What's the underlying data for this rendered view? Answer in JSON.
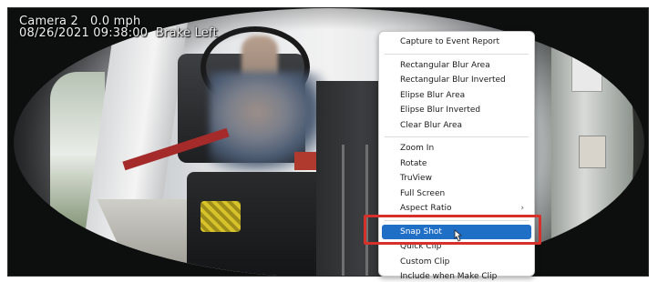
{
  "overlay": {
    "line1": "Camera 2   0.0 mph",
    "line2": "08/26/2021 09:38:00  Brake Left"
  },
  "context_menu": {
    "items": [
      {
        "label": "Capture to Event Report"
      },
      {
        "label": "Rectangular Blur Area"
      },
      {
        "label": "Rectangular Blur Inverted"
      },
      {
        "label": "Elipse Blur Area"
      },
      {
        "label": "Elipse Blur Inverted"
      },
      {
        "label": "Clear Blur Area"
      },
      {
        "label": "Zoom In"
      },
      {
        "label": "Rotate"
      },
      {
        "label": "TruView"
      },
      {
        "label": "Full Screen"
      },
      {
        "label": "Aspect Ratio",
        "submenu": true
      },
      {
        "label": "Snap Shot",
        "selected": true
      },
      {
        "label": "Quick Clip"
      },
      {
        "label": "Custom Clip"
      },
      {
        "label": "Include when Make Clip"
      }
    ],
    "submenu_arrow": "›"
  },
  "colors": {
    "selection": "#1f6fc6",
    "highlight_box": "#d6302b"
  }
}
